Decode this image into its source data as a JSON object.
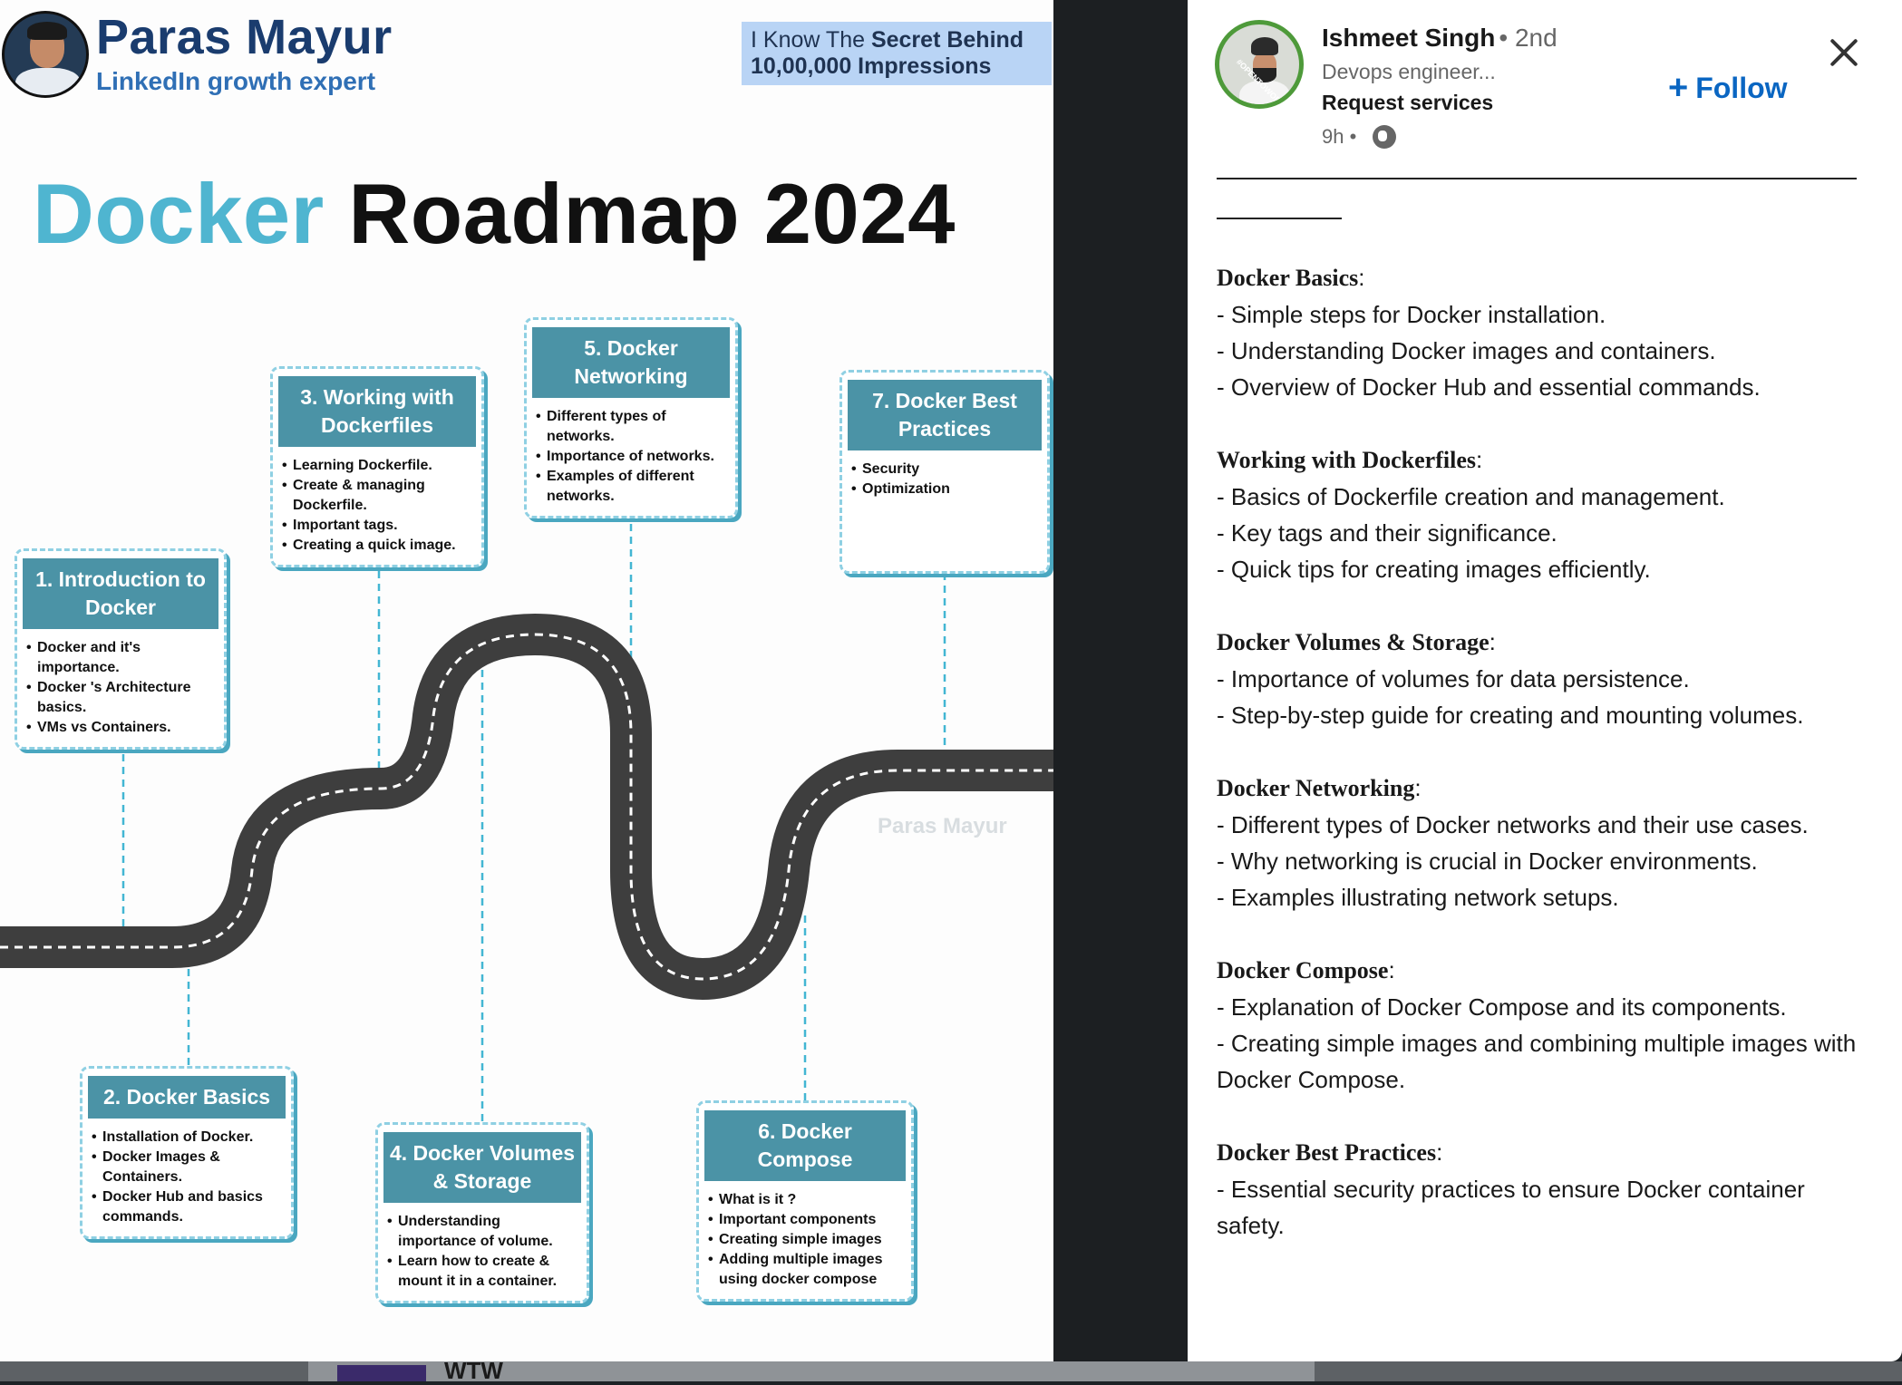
{
  "image": {
    "author_name": "Paras Mayur",
    "author_title": "LinkedIn growth expert",
    "badge_line1_normal": "I Know The ",
    "badge_line1_bold": "Secret Behind",
    "badge_line2": "10,00,000 Impressions",
    "title_accent": "Docker",
    "title_rest": " Roadmap 2024",
    "watermark": "Paras Mayur",
    "steps": [
      {
        "title": "1. Introduction to Docker",
        "items": [
          "Docker and it's importance.",
          "Docker 's Architecture basics.",
          "VMs vs Containers."
        ]
      },
      {
        "title": "2. Docker Basics",
        "items": [
          "Installation of Docker.",
          "Docker Images & Containers.",
          "Docker Hub and basics commands."
        ]
      },
      {
        "title": "3. Working with Dockerfiles",
        "items": [
          "Learning Dockerfile.",
          "Create & managing Dockerfile.",
          "Important tags.",
          "Creating a quick image."
        ]
      },
      {
        "title": "4. Docker Volumes & Storage",
        "items": [
          "Understanding importance of volume.",
          "Learn how to create & mount it in a container."
        ]
      },
      {
        "title": "5. Docker Networking",
        "items": [
          "Different types of networks.",
          "Importance of networks.",
          "Examples of different networks."
        ]
      },
      {
        "title": "6. Docker Compose",
        "items": [
          "What is it ?",
          "Important components",
          "Creating simple images",
          "Adding multiple images using docker compose"
        ]
      },
      {
        "title": "7. Docker Best Practices",
        "items": [
          "Security",
          "Optimization"
        ]
      }
    ]
  },
  "bottom_bar": {
    "text": "WTW"
  },
  "sidebar": {
    "poster_name": "Ishmeet Singh",
    "poster_degree": "• 2nd",
    "poster_headline": "Devops engineer...",
    "request_services": "Request services",
    "post_time": "9h •",
    "follow_label": "Follow",
    "avatar_ribbon": "#OPENTOWORK",
    "sections": [
      {
        "heading": "Docker Basics",
        "lines": [
          "- Simple steps for Docker installation.",
          "- Understanding Docker images and containers.",
          "- Overview of Docker Hub and essential commands."
        ]
      },
      {
        "heading": "Working with Dockerfiles",
        "lines": [
          "- Basics of Dockerfile creation and management.",
          "- Key tags and their significance.",
          "- Quick tips for creating images efficiently."
        ]
      },
      {
        "heading": "Docker Volumes & Storage",
        "lines": [
          "- Importance of volumes for data persistence.",
          "- Step-by-step guide for creating and mounting volumes."
        ]
      },
      {
        "heading": "Docker Networking",
        "lines": [
          "- Different types of Docker networks and their use cases.",
          "- Why networking is crucial in Docker environments.",
          "- Examples illustrating network setups."
        ]
      },
      {
        "heading": "Docker Compose",
        "lines": [
          "- Explanation of Docker Compose and its components.",
          "- Creating simple images and combining multiple images with Docker Compose."
        ]
      },
      {
        "heading": "Docker Best Practices",
        "lines": [
          "- Essential security practices to ensure Docker container safety."
        ]
      }
    ]
  },
  "colors": {
    "accent_blue": "#0a66c2",
    "docker_teal": "#4fb5d0",
    "card_header": "#4b93a6"
  }
}
